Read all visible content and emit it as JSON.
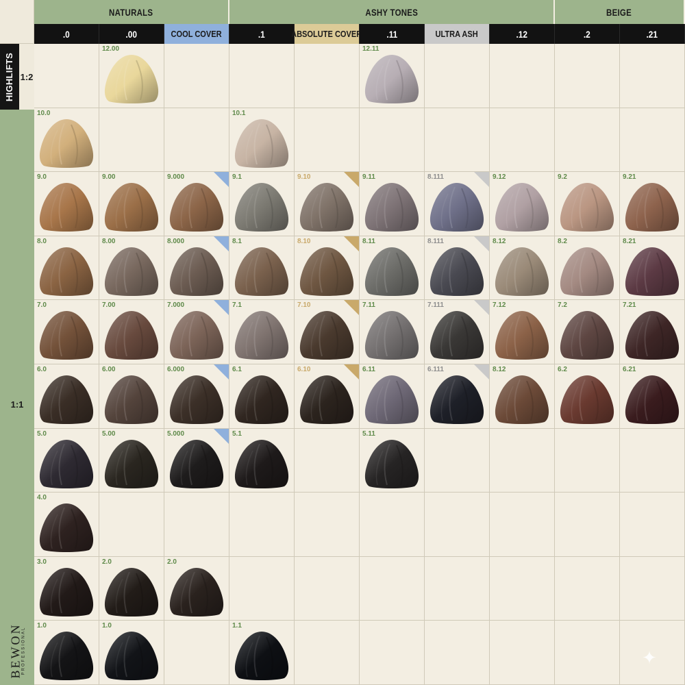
{
  "groups": [
    {
      "label": "NATURALS",
      "span": 3
    },
    {
      "label": "ASHY TONES",
      "span": 5
    },
    {
      "label": "BEIGE",
      "span": 2
    }
  ],
  "columns": [
    {
      "label": ".0",
      "special": false
    },
    {
      "label": ".00",
      "special": false
    },
    {
      "label": "COOL COVER",
      "special": true,
      "bg": "#8fb0dc"
    },
    {
      "label": ".1",
      "special": false
    },
    {
      "label": "ABSOLUTE COVER",
      "special": true,
      "bg": "#dccb97"
    },
    {
      "label": ".11",
      "special": false
    },
    {
      "label": "ULTRA ASH",
      "special": true,
      "bg": "#c9c9c9"
    },
    {
      "label": ".12",
      "special": false
    },
    {
      "label": ".2",
      "special": false
    },
    {
      "label": ".21",
      "special": false
    }
  ],
  "side": {
    "highlifts": "HIGHLIFTS",
    "ratio_top": "1:2",
    "ratio_main": "1:1",
    "brand": "BEWON",
    "brand_sub": "PROFESSIONAL"
  },
  "colors": {
    "group_green": "#9db48c",
    "header_black": "#121212",
    "background": "#f3eee2",
    "code_green": "#5f8a4a",
    "absolute_gold": "#c9a96a",
    "cool_blue": "#8fb0dc",
    "ultra_gray": "#c9c9c9"
  },
  "rows": [
    {
      "cells": [
        null,
        {
          "code": "12.00",
          "color": "#e9d79b"
        },
        null,
        null,
        null,
        {
          "code": "12.11",
          "color": "#b7aeb4"
        },
        null,
        null,
        null,
        null
      ]
    },
    {
      "cells": [
        {
          "code": "10.0",
          "color": "#d2b07c"
        },
        null,
        null,
        {
          "code": "10.1",
          "color": "#c7b4a4"
        },
        null,
        null,
        null,
        null,
        null,
        null
      ]
    },
    {
      "cells": [
        {
          "code": "9.0",
          "color": "#a8764a"
        },
        {
          "code": "9.00",
          "color": "#9b6f48"
        },
        {
          "code": "9.000",
          "color": "#8c6548",
          "tri": "cool"
        },
        {
          "code": "9.1",
          "color": "#7c7a72"
        },
        {
          "code": "9.10",
          "color": "#7f7268",
          "tri": "abs"
        },
        {
          "code": "9.11",
          "color": "#7e7376"
        },
        {
          "code": "8.111",
          "color": "#6f7089",
          "tri": "ultra"
        },
        {
          "code": "9.12",
          "color": "#b0a0a3"
        },
        {
          "code": "9.2",
          "color": "#ba9682"
        },
        {
          "code": "9.21",
          "color": "#8e634d"
        }
      ]
    },
    {
      "cells": [
        {
          "code": "8.0",
          "color": "#8b6443"
        },
        {
          "code": "8.00",
          "color": "#78685e"
        },
        {
          "code": "8.000",
          "color": "#6c5c52",
          "tri": "cool"
        },
        {
          "code": "8.1",
          "color": "#7a614d"
        },
        {
          "code": "8.10",
          "color": "#6f5742",
          "tri": "abs"
        },
        {
          "code": "8.11",
          "color": "#6c6c68"
        },
        {
          "code": "8.111",
          "color": "#4a4a52",
          "tri": "ultra"
        },
        {
          "code": "8.12",
          "color": "#9a8a78"
        },
        {
          "code": "8.2",
          "color": "#a48a82"
        },
        {
          "code": "8.21",
          "color": "#5c3a44"
        }
      ]
    },
    {
      "cells": [
        {
          "code": "7.0",
          "color": "#74523a"
        },
        {
          "code": "7.00",
          "color": "#684a3e"
        },
        {
          "code": "7.000",
          "color": "#7c6458",
          "tri": "cool"
        },
        {
          "code": "7.1",
          "color": "#807470"
        },
        {
          "code": "7.10",
          "color": "#4a3a2e",
          "tri": "abs"
        },
        {
          "code": "7.11",
          "color": "#747070"
        },
        {
          "code": "7.111",
          "color": "#3a3836",
          "tri": "ultra"
        },
        {
          "code": "7.12",
          "color": "#8c6248"
        },
        {
          "code": "7.2",
          "color": "#5e4642"
        },
        {
          "code": "7.21",
          "color": "#3e2626"
        }
      ]
    },
    {
      "cells": [
        {
          "code": "6.0",
          "color": "#3a2e26"
        },
        {
          "code": "6.00",
          "color": "#54443c"
        },
        {
          "code": "6.000",
          "color": "#3c3028",
          "tri": "cool"
        },
        {
          "code": "6.1",
          "color": "#302620"
        },
        {
          "code": "6.10",
          "color": "#2c241e",
          "tri": "abs"
        },
        {
          "code": "6.11",
          "color": "#6e6876"
        },
        {
          "code": "6.111",
          "color": "#1e2028",
          "tri": "ultra"
        },
        {
          "code": "8.12",
          "color": "#6c4a38"
        },
        {
          "code": "6.2",
          "color": "#6a3a30"
        },
        {
          "code": "6.21",
          "color": "#3a1c1e"
        }
      ]
    },
    {
      "cells": [
        {
          "code": "5.0",
          "color": "#2e2a32"
        },
        {
          "code": "5.00",
          "color": "#2a2620"
        },
        {
          "code": "5.000",
          "color": "#1e1c1c",
          "tri": "cool"
        },
        {
          "code": "5.1",
          "color": "#1e1a1a"
        },
        null,
        {
          "code": "5.11",
          "color": "#262424"
        },
        null,
        null,
        null,
        null
      ]
    },
    {
      "cells": [
        {
          "code": "4.0",
          "color": "#2e2220"
        },
        null,
        null,
        null,
        null,
        null,
        null,
        null,
        null,
        null
      ]
    },
    {
      "cells": [
        {
          "code": "3.0",
          "color": "#221a18"
        },
        {
          "code": "2.0",
          "color": "#221c18"
        },
        {
          "code": "2.0",
          "color": "#2a221e"
        },
        null,
        null,
        null,
        null,
        null,
        null,
        null
      ]
    },
    {
      "cells": [
        {
          "code": "1.0",
          "color": "#141416"
        },
        {
          "code": "1.0",
          "color": "#121418"
        },
        null,
        {
          "code": "1.1",
          "color": "#0e1014"
        },
        null,
        null,
        null,
        null,
        null,
        null
      ]
    }
  ]
}
